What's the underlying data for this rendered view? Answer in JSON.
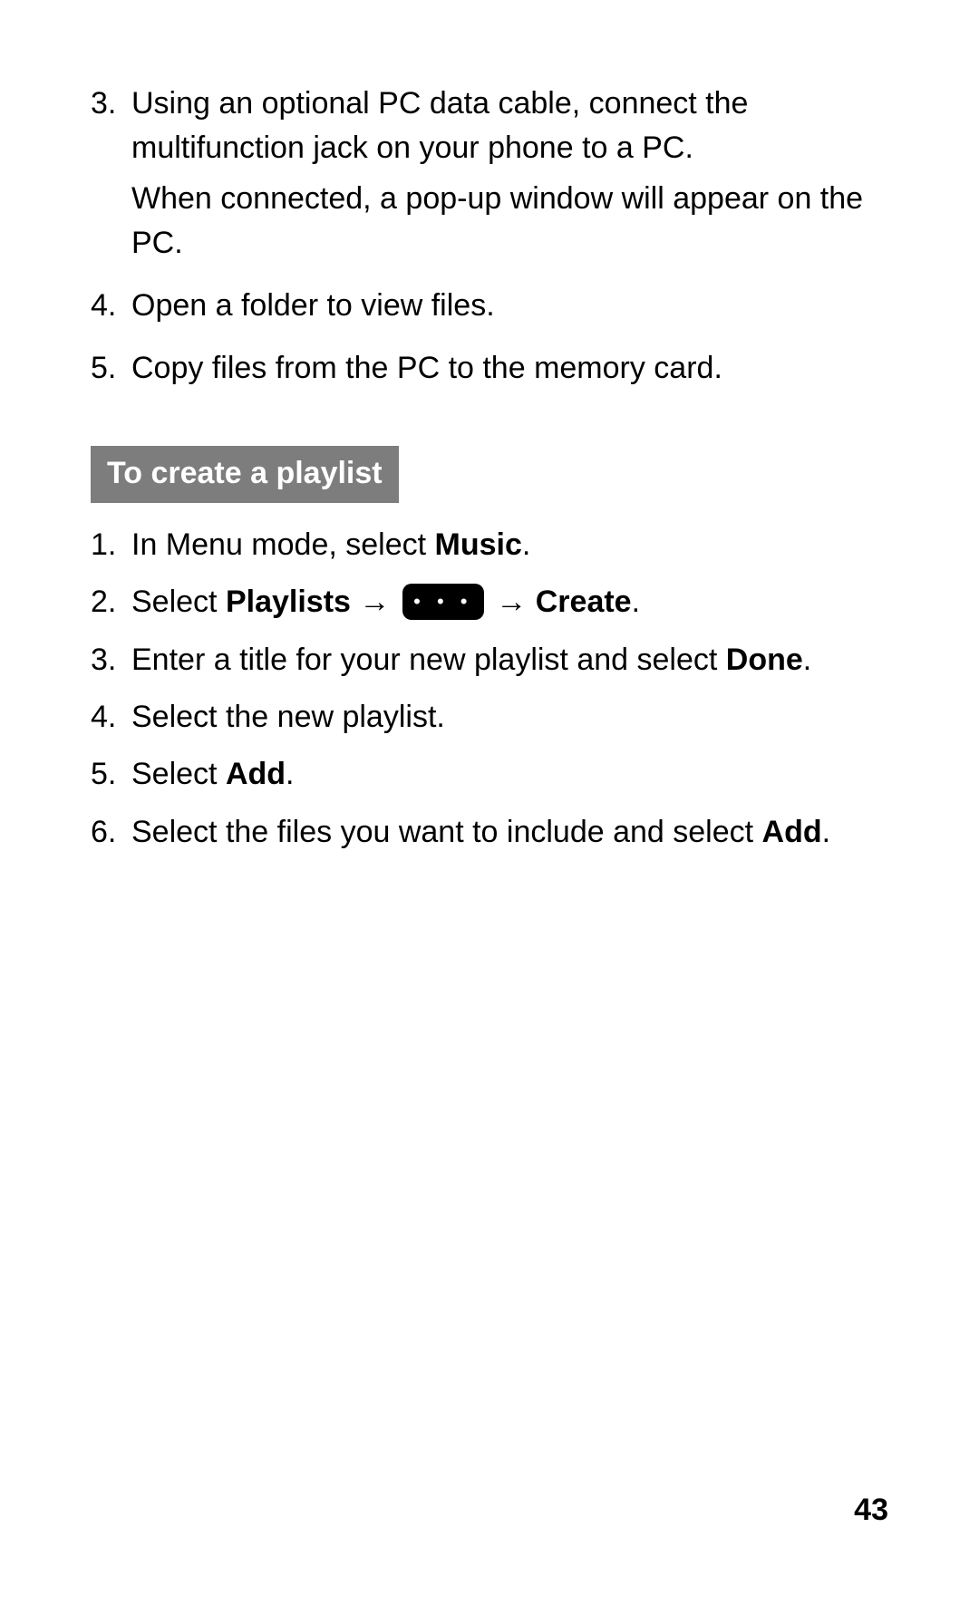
{
  "list1": [
    {
      "num": "3.",
      "paras": [
        "Using an optional PC data cable, connect the multifunction jack on your phone to a PC.",
        "When connected, a pop-up window will appear on the PC."
      ]
    },
    {
      "num": "4.",
      "paras": [
        "Open a folder to view files."
      ]
    },
    {
      "num": "5.",
      "paras": [
        "Copy files from the PC to the memory card."
      ]
    }
  ],
  "heading": "To create a playlist",
  "list2": {
    "item1": {
      "num": "1.",
      "a": "In Menu mode, select ",
      "b": "Music",
      "c": "."
    },
    "item2": {
      "num": "2.",
      "a": "Select ",
      "b": "Playlists",
      "arrow1": " → ",
      "more": "• • •",
      "arrow2": " → ",
      "d": "Create",
      "e": "."
    },
    "item3": {
      "num": "3.",
      "a": "Enter a title for your new playlist and select ",
      "b": "Done",
      "c": "."
    },
    "item4": {
      "num": "4.",
      "a": "Select the new playlist."
    },
    "item5": {
      "num": "5.",
      "a": "Select ",
      "b": "Add",
      "c": "."
    },
    "item6": {
      "num": "6.",
      "a": "Select the files you want to include and select ",
      "b": "Add",
      "c": "."
    }
  },
  "page_number": "43"
}
